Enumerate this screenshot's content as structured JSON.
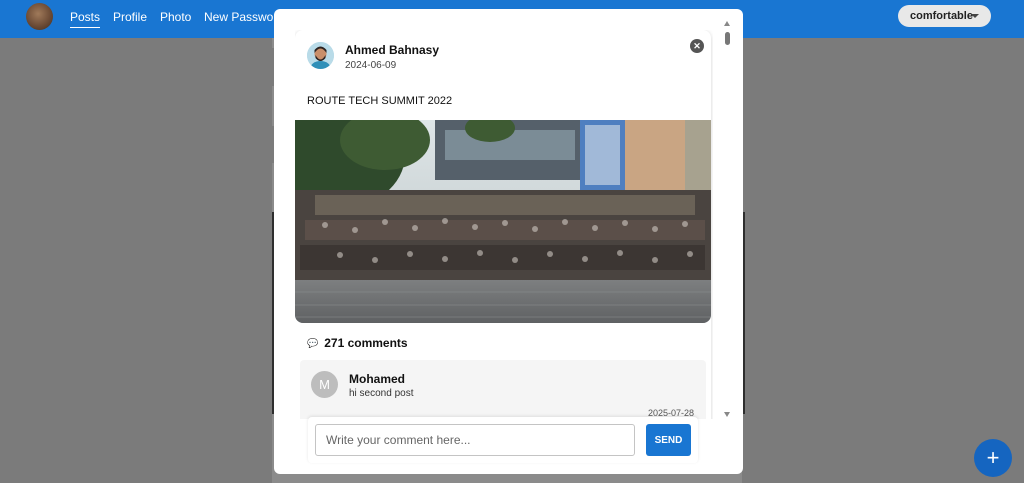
{
  "navbar": {
    "links": [
      {
        "label": "Posts",
        "active": true
      },
      {
        "label": "Profile"
      },
      {
        "label": "Photo"
      },
      {
        "label": "New Password"
      }
    ],
    "density_label": "comfortable"
  },
  "fab": {
    "icon": "plus-icon",
    "label": "+"
  },
  "post": {
    "author": "Ahmed Bahnasy",
    "date": "2024-06-09",
    "body": "ROUTE TECH SUMMIT 2022",
    "comments_count_label": "271 comments",
    "comment_icon": "speech-bubble-icon"
  },
  "comment": {
    "avatar_letter": "M",
    "name": "Mohamed",
    "text": "hi second post",
    "date": "2025-07-28"
  },
  "composer": {
    "placeholder": "Write your comment here...",
    "send_label": "SEND"
  },
  "colors": {
    "primary": "#1976d2",
    "backdrop": "#7b7b7b"
  }
}
